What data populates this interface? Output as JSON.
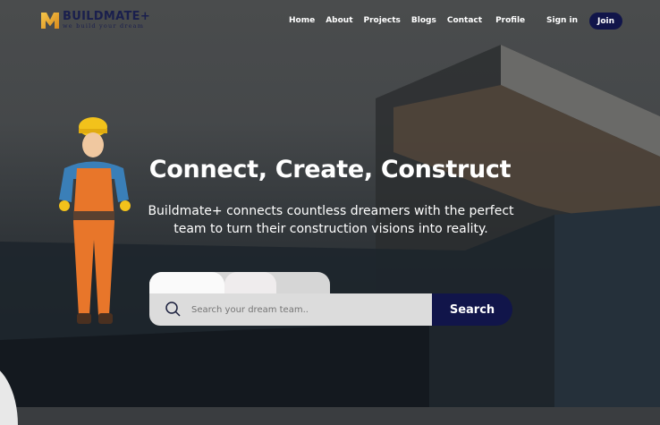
{
  "nav": {
    "brand": "BUILDMATE+",
    "tagline": "we build your dream",
    "links": [
      "Home",
      "About",
      "Projects",
      "Blogs",
      "Contact",
      "Profile"
    ],
    "sign_in": "Sign in",
    "join": "Join"
  },
  "hero": {
    "title": "Connect, Create, Construct",
    "subtitle": "Buildmate+ connects countless dreamers with the perfect team to turn their construction visions into reality."
  },
  "search": {
    "placeholder": "Search your dream team..",
    "button": "Search"
  },
  "colors": {
    "accent": "#11154a",
    "brand_gold": "#f4c64a"
  }
}
